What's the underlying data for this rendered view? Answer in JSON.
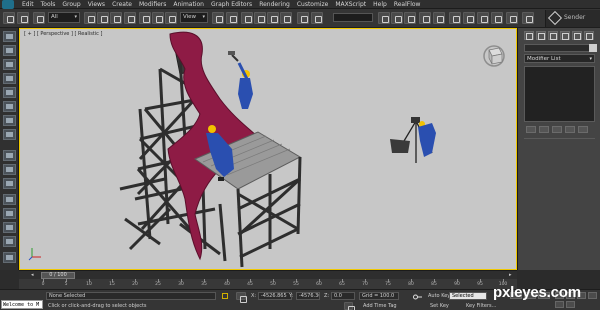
{
  "menubar": {
    "items": [
      "Edit",
      "Tools",
      "Group",
      "Views",
      "Create",
      "Modifiers",
      "Animation",
      "Graph Editors",
      "Rendering",
      "Customize",
      "MAXScript",
      "Help",
      "RealFlow"
    ]
  },
  "toolbar": {
    "selection_filter": "All",
    "ref_coord": "View",
    "sender_label": "Sender"
  },
  "viewport": {
    "label": "[ + ] [ Perspective ] [ Realistic ]"
  },
  "command_panel": {
    "modifier_list": "Modifier List"
  },
  "timeline": {
    "frame": "0 / 100",
    "ticks": [
      "0",
      "5",
      "10",
      "15",
      "20",
      "25",
      "30",
      "35",
      "40",
      "45",
      "50",
      "55",
      "60",
      "65",
      "70",
      "75",
      "80",
      "85",
      "90",
      "95",
      "100"
    ]
  },
  "status": {
    "maxscript": "Welcome to M",
    "selection": "None Selected",
    "prompt": "Click or click-and-drag to select objects",
    "x_label": "X:",
    "x_value": "-4526.865",
    "y_label": "Y:",
    "y_value": "-4576.365",
    "z_label": "Z:",
    "z_value": "0.0",
    "grid": "Grid = 100.0",
    "add_time_tag": "Add Time Tag",
    "auto_key": "Auto Key",
    "auto_key_value": "Selected",
    "set_key": "Set Key",
    "key_filters": "Key Filters..."
  },
  "watermark": "pxleyes.com",
  "colors": {
    "viewport_bg": "#c7c7c7",
    "viewport_border": "#f0c800",
    "cloth": "#8e1b45",
    "workers": "#2a4fb0",
    "helmet": "#f2c200"
  }
}
